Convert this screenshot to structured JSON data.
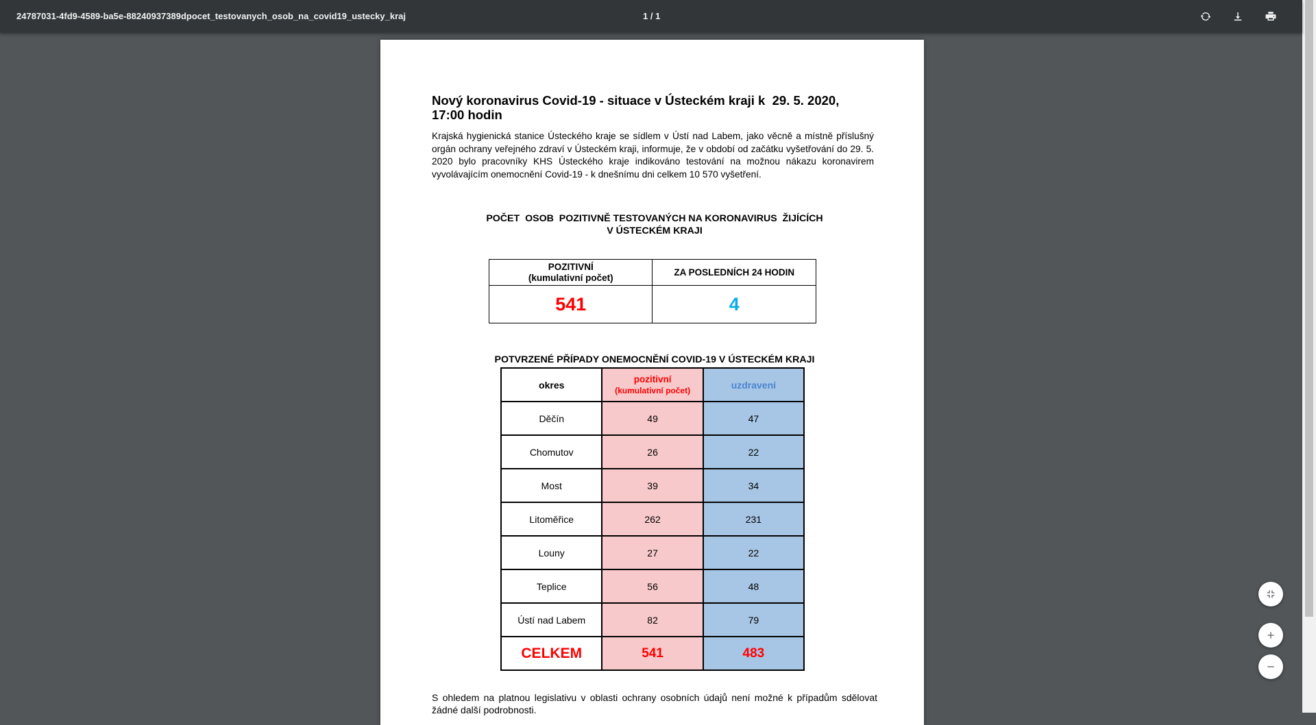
{
  "toolbar": {
    "file_title": "24787031-4fd9-4589-ba5e-88240937389dpocet_testovanych_osob_na_covid19_ustecky_kraj",
    "page_indicator": "1 / 1",
    "icons": [
      "rotate-icon",
      "download-icon",
      "print-icon"
    ]
  },
  "document": {
    "title_line1": "Nový koronavirus Covid-19 - situace v Ústeckém kraji k  29. 5. 2020,",
    "title_line2": "17:00 hodin",
    "intro": "Krajská hygienická stanice Ústeckého kraje se sídlem v Ústí nad Labem, jako věcně a místně příslušný orgán ochrany veřejného zdraví v Ústeckém kraji, informuje, že v období od začátku vyšetřování do 29. 5. 2020 bylo pracovníky KHS Ústeckého kraje indikováno testování na možnou nákazu koronavirem vyvolávajícím onemocnění Covid-19 - k dnešnímu dni celkem 10 570 vyšetření.",
    "section1_title_line1": "POČET  OSOB  POZITIVNĚ TESTOVANÝCH NA KORONAVIRUS  ŽIJÍCÍCH",
    "section1_title_line2": "V ÚSTECKÉM KRAJI",
    "summary": {
      "col1_header_line1": "POZITIVNÍ",
      "col1_header_line2": "(kumulativní počet)",
      "col2_header": "ZA POSLEDNÍCH 24 HODIN",
      "positive_total": "541",
      "last_24h": "4"
    },
    "section2_title": "POTVRZENÉ PŘÍPADY ONEMOCNĚNÍ COVID-19 V ÚSTECKÉM KRAJI",
    "districts_table": {
      "header_okres": "okres",
      "header_pozitivni_line1": "pozitivní",
      "header_pozitivni_line2": "(kumulativní počet)",
      "header_uzdraveni": "uzdravení",
      "rows": [
        {
          "okres": "Děčín",
          "pozitivni": "49",
          "uzdraveni": "47"
        },
        {
          "okres": "Chomutov",
          "pozitivni": "26",
          "uzdraveni": "22"
        },
        {
          "okres": "Most",
          "pozitivni": "39",
          "uzdraveni": "34"
        },
        {
          "okres": "Litoměřice",
          "pozitivni": "262",
          "uzdraveni": "231"
        },
        {
          "okres": "Louny",
          "pozitivni": "27",
          "uzdraveni": "22"
        },
        {
          "okres": "Teplice",
          "pozitivni": "56",
          "uzdraveni": "48"
        },
        {
          "okres": "Ústí nad Labem",
          "pozitivni": "82",
          "uzdraveni": "79"
        }
      ],
      "total_label": "CELKEM",
      "total_pozitivni": "541",
      "total_uzdraveni": "483"
    },
    "footer": "S ohledem na platnou legislativu v oblasti ochrany osobních údajů není možné k případům sdělovat žádné další podrobnosti."
  },
  "zoom_controls": [
    "fit-page-icon",
    "zoom-in-icon",
    "zoom-out-icon"
  ],
  "colors": {
    "toolbar_bg": "#323639",
    "viewer_bg": "#525659",
    "positive_red": "#ff0000",
    "last24_cyan": "#0aabe8",
    "pink_cell": "#f7c9ca",
    "blue_cell": "#a7c5e4"
  }
}
